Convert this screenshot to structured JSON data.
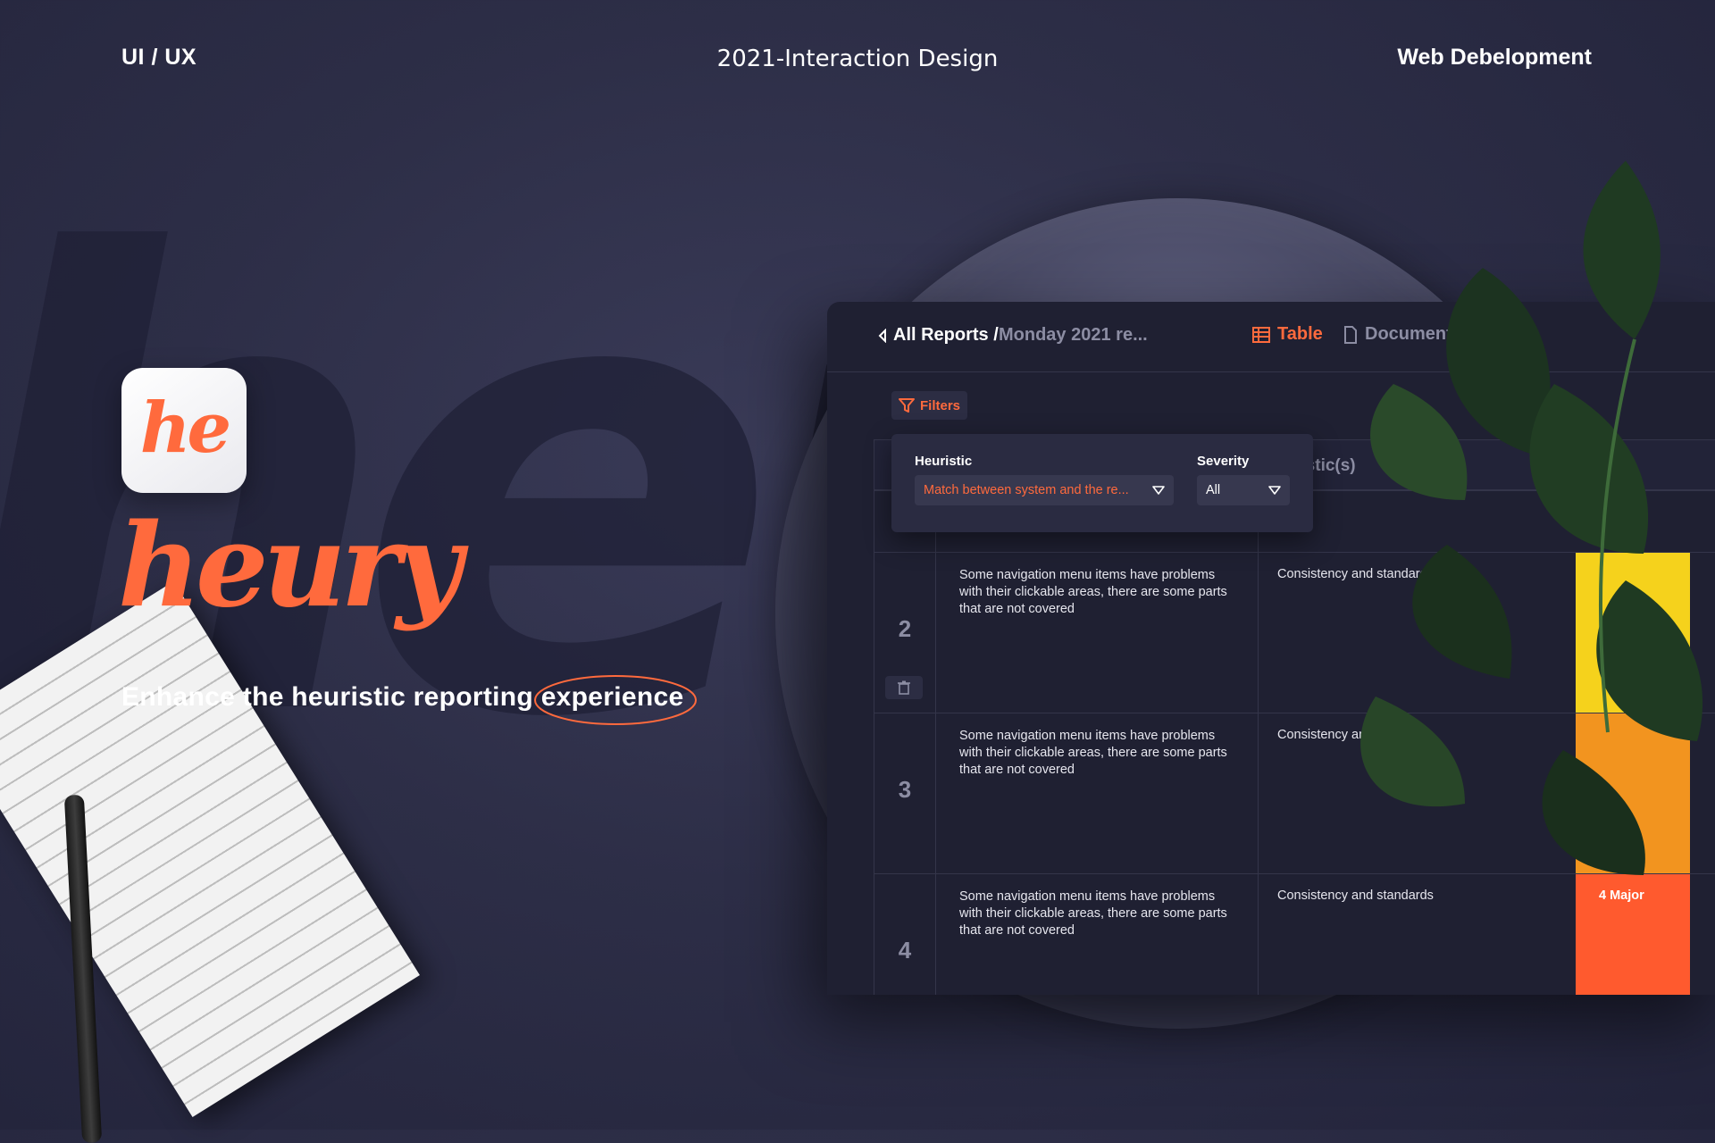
{
  "header": {
    "left": "UI / UX",
    "center": "2021-Interaction Design",
    "right": "Web Debelopment"
  },
  "hero": {
    "background_word": "heu",
    "app_icon_text": "he",
    "brand_name": "heury",
    "tagline_prefix": "Enhance the heuristic reporting ",
    "tagline_highlight": "experience"
  },
  "panel": {
    "breadcrumb_root": "All Reports /",
    "breadcrumb_current": "Monday 2021 re...",
    "tabs": [
      {
        "label": "Table",
        "icon": "table-icon",
        "active": true
      },
      {
        "label": "Document",
        "icon": "document-icon",
        "active": false
      }
    ],
    "filters_label": "Filters",
    "filter_popover": {
      "heuristic_label": "Heuristic",
      "heuristic_value": "Match between system and the re...",
      "severity_label": "Severity",
      "severity_value": "All"
    },
    "table": {
      "column_header_visible": "ristic(s)",
      "rows": [
        {
          "num": "2",
          "description": "Some navigation menu items have problems with their clickable areas, there are some parts that are not covered",
          "heuristic": "Consistency and standards",
          "severity_label": "",
          "severity_color": "#f5d21c"
        },
        {
          "num": "3",
          "description": "Some navigation menu items have problems with their clickable areas, there are some parts that are not covered",
          "heuristic": "Consistency and standards",
          "severity_label": "",
          "severity_color": "#f2941f"
        },
        {
          "num": "4",
          "description": "Some navigation menu items have problems with their clickable areas, there are some parts that are not covered",
          "heuristic": "Consistency and standards",
          "severity_label": "4 Major",
          "severity_color": "#ff5a2e"
        }
      ]
    }
  },
  "colors": {
    "accent": "#ff6a3d",
    "background": "#2d2e47",
    "panel": "#1f2032"
  }
}
